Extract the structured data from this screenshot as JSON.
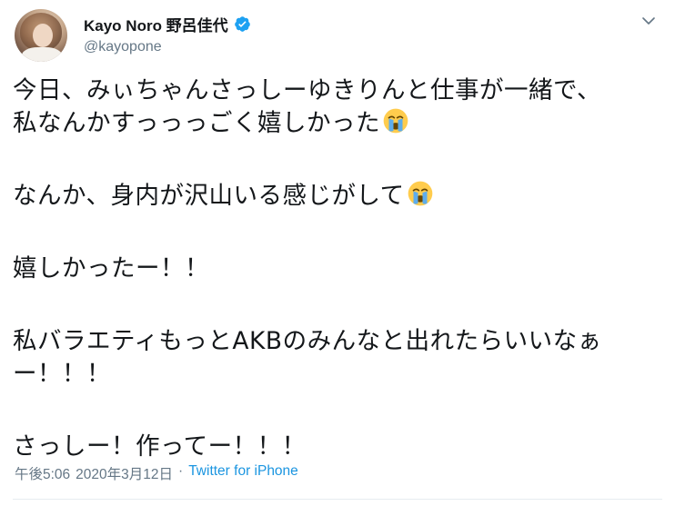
{
  "author": {
    "display_name": "Kayo Noro 野呂佳代",
    "handle": "@kayopone",
    "verified": true
  },
  "tweet": {
    "lines": [
      "今日、みぃちゃんさっしーゆきりんと仕事が一緒で、",
      "私なんかすっっっごく嬉しかった",
      "なんか、身内が沢山いる感じがして",
      "嬉しかったー！！",
      "私バラエティもっとAKBのみんなと出れたらいいなぁ",
      "ー！！！",
      "さっしー！作ってー！！！"
    ],
    "emoji": "loudly-crying-face-emoji"
  },
  "meta": {
    "time": "午後5:06",
    "separator": "·",
    "date": "2020年3月12日",
    "source": "Twitter for iPhone"
  },
  "colors": {
    "verified_blue": "#1da1f2",
    "link_blue": "#1b95e0",
    "secondary_gray": "#657786",
    "text": "#14171a"
  },
  "icons": {
    "menu": "chevron-down-icon",
    "verified": "verified-badge-icon"
  }
}
